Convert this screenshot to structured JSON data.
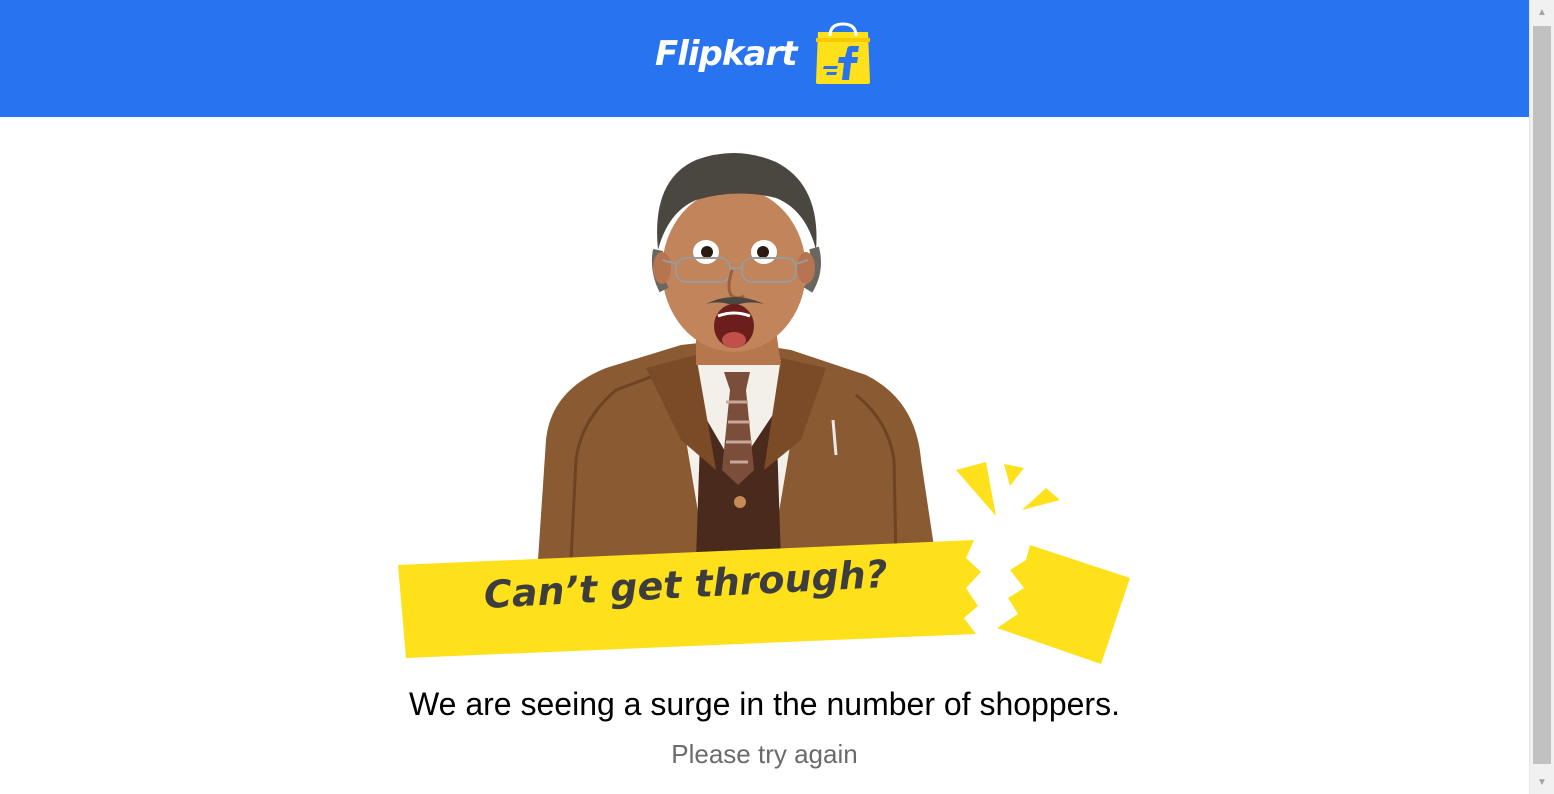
{
  "header": {
    "brand_name": "Flipkart",
    "brand_color": "#2874f0",
    "logo_icon": "flipkart-bag-icon"
  },
  "hero": {
    "headline": "Can’t get through?",
    "banner_color": "#ffe11b",
    "headline_color": "#3d3d3d"
  },
  "message": {
    "main": "We are seeing a surge in the number of shoppers.",
    "sub": "Please try again"
  },
  "scrollbar": {
    "up_icon": "triangle-up-icon",
    "down_icon": "triangle-down-icon"
  }
}
